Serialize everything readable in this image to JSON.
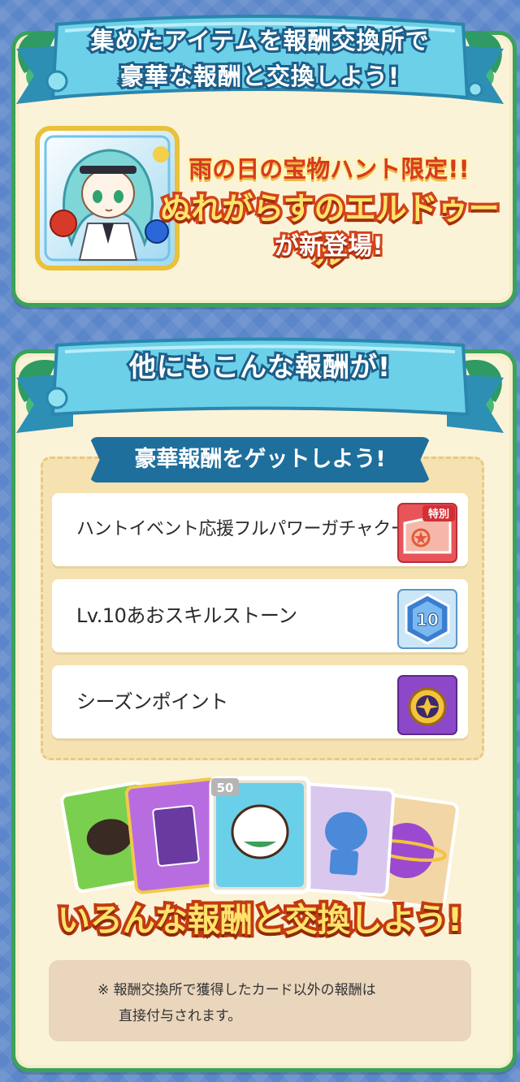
{
  "banner_top": {
    "line1": "集めたアイテムを報酬交換所で",
    "line2": "豪華な報酬と交換しよう!"
  },
  "feature": {
    "line1": "雨の日の宝物ハント限定!!",
    "line2": "ぬれがらすのエルドゥール",
    "line3": "が新登場!",
    "card_icon": "character-card"
  },
  "banner_second": {
    "title": "他にもこんな報酬が!"
  },
  "rewards": {
    "subtitle": "豪華報酬をゲットしよう!",
    "items": [
      {
        "label": "ハントイベント応援フルパワーガチャクーポン",
        "icon": "gacha-ticket-icon",
        "badge": "特別"
      },
      {
        "label": "Lv.10あおスキルストーン",
        "icon": "skill-stone-icon",
        "badge": "10"
      },
      {
        "label": "シーズンポイント",
        "icon": "season-point-coin-icon"
      }
    ]
  },
  "cards_showcase": {
    "badge": "50",
    "title": "いろんな報酬と交換しよう!"
  },
  "note": {
    "line1": "※ 報酬交換所で獲得したカード以外の報酬は",
    "line2": "直接付与されます。"
  },
  "colors": {
    "background": "#5b86c9",
    "panel": "#fbf3d7",
    "panel_border": "#3aa25a",
    "banner": "#4bb9d6",
    "accent_red": "#d3431b"
  }
}
